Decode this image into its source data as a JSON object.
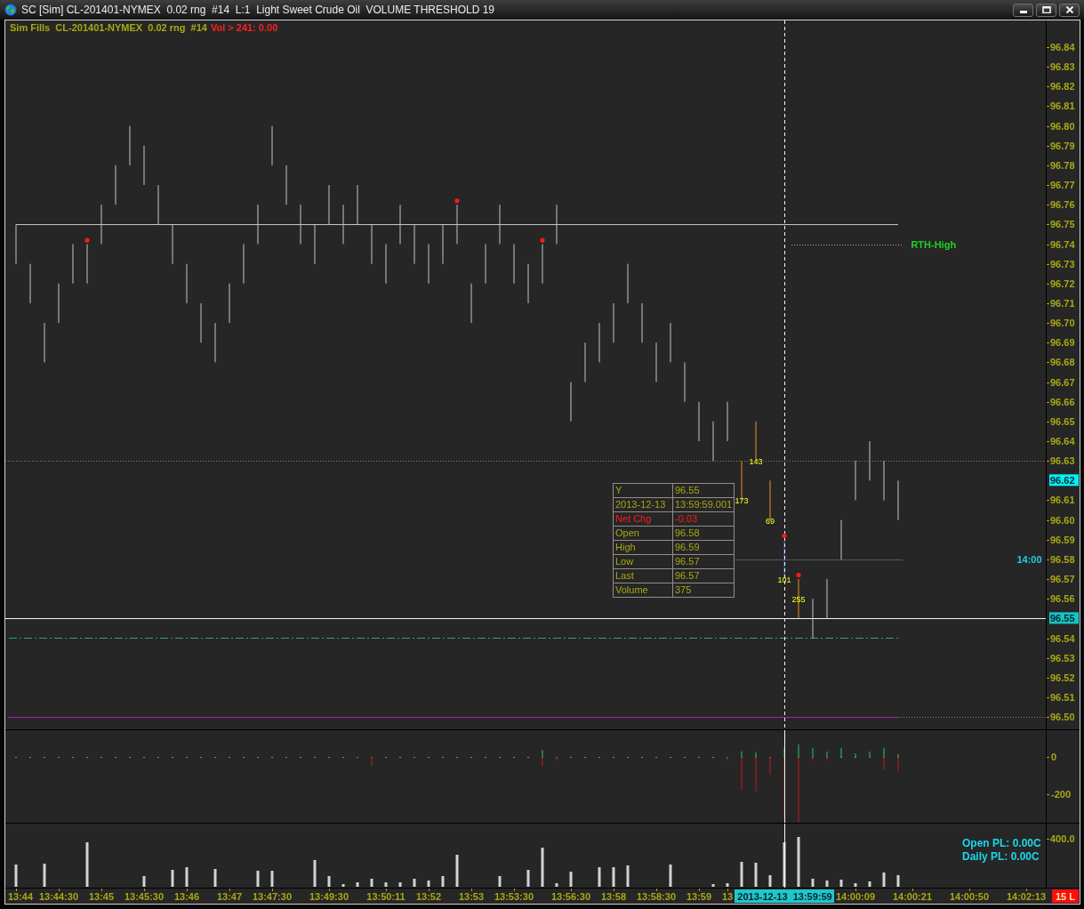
{
  "window": {
    "title": "SC [Sim] CL-201401-NYMEX  0.02 rng  #14  L:1  Light Sweet Crude Oil  VOLUME THRESHOLD 19",
    "buttons": [
      {
        "kind": "minimize"
      },
      {
        "kind": "maximize"
      },
      {
        "kind": "close"
      }
    ]
  },
  "chart_header": {
    "title": "Sim Fills  CL-201401-NYMEX  0.02 rng  #14",
    "study": "Vol > 241: 0.00"
  },
  "price_pane": {
    "axis": [
      {
        "kind": "tick",
        "label": "96.84"
      },
      {
        "kind": "tick",
        "label": "96.83"
      },
      {
        "kind": "tick",
        "label": "96.82"
      },
      {
        "kind": "tick",
        "label": "96.81"
      },
      {
        "kind": "tick",
        "label": "96.80"
      },
      {
        "kind": "tick",
        "label": "96.79"
      },
      {
        "kind": "tick",
        "label": "96.78"
      },
      {
        "kind": "tick",
        "label": "96.77"
      },
      {
        "kind": "tick",
        "label": "96.76"
      },
      {
        "kind": "tick",
        "label": "96.75"
      },
      {
        "kind": "tick",
        "label": "96.74"
      },
      {
        "kind": "tick",
        "label": "96.73"
      },
      {
        "kind": "tick",
        "label": "96.72"
      },
      {
        "kind": "tick",
        "label": "96.71"
      },
      {
        "kind": "tick",
        "label": "96.70"
      },
      {
        "kind": "tick",
        "label": "96.69"
      },
      {
        "kind": "tick",
        "label": "96.68"
      },
      {
        "kind": "tick",
        "label": "96.67"
      },
      {
        "kind": "tick",
        "label": "96.66"
      },
      {
        "kind": "tick",
        "label": "96.65"
      },
      {
        "kind": "tick",
        "label": "96.64"
      },
      {
        "kind": "tick",
        "label": "96.63"
      },
      {
        "kind": "last",
        "label": "96.62",
        "color": "#00f0f8"
      },
      {
        "kind": "tick",
        "label": "96.61"
      },
      {
        "kind": "tick",
        "label": "96.60"
      },
      {
        "kind": "tick",
        "label": "96.59"
      },
      {
        "kind": "tick",
        "label": "96.58"
      },
      {
        "kind": "tick",
        "label": "96.57"
      },
      {
        "kind": "tick",
        "label": "96.56"
      },
      {
        "kind": "cursor",
        "label": "96.55",
        "color": "#14c4c8"
      },
      {
        "kind": "tick",
        "label": "96.54"
      },
      {
        "kind": "tick",
        "label": "96.53"
      },
      {
        "kind": "tick",
        "label": "96.52"
      },
      {
        "kind": "tick",
        "label": "96.51"
      },
      {
        "kind": "tick",
        "label": "96.50"
      }
    ],
    "volume_labels": [
      "143",
      "173",
      "69",
      "101",
      "255"
    ],
    "line_labels": [
      {
        "text": "RTH-High",
        "color": "#1ed21e"
      },
      {
        "text": "14:00",
        "color": "#1ccfe0"
      }
    ]
  },
  "data_window": {
    "rows": [
      {
        "label": "Y",
        "value": "96.55",
        "color": "#a8a814"
      },
      {
        "label": "2013-12-13",
        "value": "13:59:59.001",
        "color": "#a8a814"
      },
      {
        "label": "Net Chg",
        "value": "-0.03",
        "color": "#ff1c1c"
      },
      {
        "label": "Open",
        "value": "96.58",
        "color": "#a8a814"
      },
      {
        "label": "High",
        "value": "96.59",
        "color": "#a8a814"
      },
      {
        "label": "Low",
        "value": "96.57",
        "color": "#a8a814"
      },
      {
        "label": "Last",
        "value": "96.57",
        "color": "#a8a814"
      },
      {
        "label": "Volume",
        "value": "375",
        "color": "#a8a814"
      }
    ]
  },
  "delta_pane": {
    "axis": [
      "0",
      "-200"
    ]
  },
  "volume_pane": {
    "axis_label": "400.0",
    "pl": [
      "Open PL: 0.00C",
      "Daily PL: 0.00C"
    ]
  },
  "time_axis": {
    "ticks": [
      "13:44",
      "13:44:30",
      "13:45",
      "13:45:30",
      "13:46",
      "13:47",
      "13:47:30",
      "13:49:30",
      "13:50:11",
      "13:52",
      "13:53",
      "13:53:30",
      "13:56:30",
      "13:58",
      "13:58:30",
      "13:59",
      "13",
      "14:00:09",
      "14:00:21",
      "14:00:50",
      "14:02:13"
    ],
    "cursor_label": "2013-12-13  13:59:59",
    "badge": "15 L"
  }
}
